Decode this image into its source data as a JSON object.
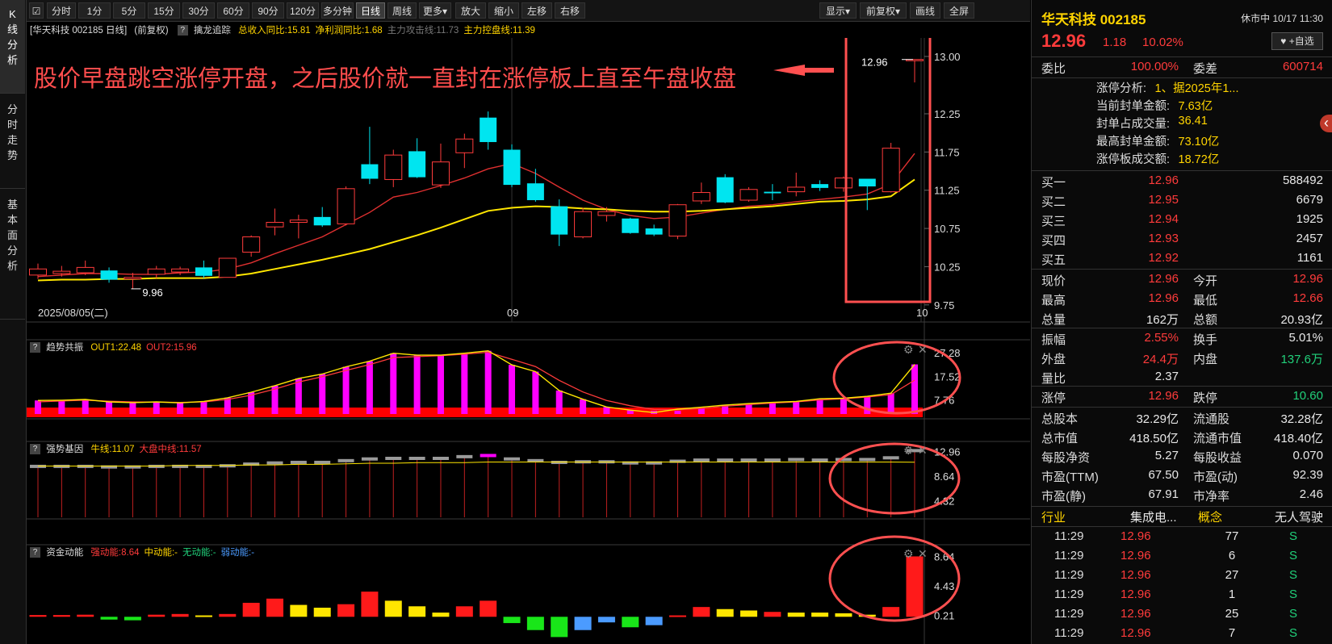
{
  "sidebar": {
    "tabs": [
      {
        "label": "K\n线\n分\n析",
        "active": true
      },
      {
        "label": "分\n时\n走\n势",
        "active": false
      },
      {
        "label": "基\n本\n面\n分\n析",
        "active": false
      }
    ]
  },
  "toolbar": {
    "periods": [
      "分时",
      "1分",
      "5分",
      "15分",
      "30分",
      "60分",
      "90分",
      "120分",
      "多分钟",
      "日线",
      "周线",
      "更多▾"
    ],
    "active_period": "日线",
    "tools": [
      "放大",
      "缩小",
      "左移",
      "右移"
    ],
    "right": [
      "显示▾",
      "前复权▾",
      "画线",
      "全屏"
    ]
  },
  "chart_header": {
    "stock": "[华天科技 002185 日线]",
    "adjust": "(前复权)",
    "indicator": "擒龙追踪",
    "items": [
      {
        "text": "总收入同比:15.81",
        "color": "#ffd400"
      },
      {
        "text": "净利润同比:1.68",
        "color": "#ffd400"
      },
      {
        "text": "主力攻击线:11.73",
        "color": "#777777"
      },
      {
        "text": "主力控盘线:11.39",
        "color": "#ffd400"
      }
    ]
  },
  "annotation": {
    "text": "股价早盘跳空涨停开盘，之后股价就一直封在涨停板上直至午盘收盘",
    "color": "#ff4d4d"
  },
  "chart_data": [
    {
      "type": "candlestick",
      "title": "华天科技 002185 日线",
      "ylim": [
        9.6,
        13.2
      ],
      "y_ticks": [
        "13.00",
        "12.25",
        "11.75",
        "11.25",
        "10.75",
        "10.25",
        "9.75"
      ],
      "x_labels": [
        {
          "index": 0,
          "text": "2025/08/05(二)"
        },
        {
          "index": 20,
          "text": "09"
        },
        {
          "index": 37,
          "text": "10"
        }
      ],
      "max_label": "12.96",
      "min_label": "9.96",
      "candles": [
        {
          "o": 10.14,
          "c": 10.22,
          "h": 10.29,
          "l": 10.09
        },
        {
          "o": 10.16,
          "c": 10.19,
          "h": 10.26,
          "l": 10.12
        },
        {
          "o": 10.17,
          "c": 10.24,
          "h": 10.33,
          "l": 10.14
        },
        {
          "o": 10.2,
          "c": 10.08,
          "h": 10.24,
          "l": 10.04
        },
        {
          "o": 10.09,
          "c": 10.11,
          "h": 10.17,
          "l": 9.96
        },
        {
          "o": 10.15,
          "c": 10.22,
          "h": 10.26,
          "l": 10.1
        },
        {
          "o": 10.18,
          "c": 10.22,
          "h": 10.25,
          "l": 10.14
        },
        {
          "o": 10.24,
          "c": 10.13,
          "h": 10.33,
          "l": 10.1
        },
        {
          "o": 10.11,
          "c": 10.36,
          "h": 10.36,
          "l": 10.11
        },
        {
          "o": 10.44,
          "c": 10.64,
          "h": 10.66,
          "l": 10.38
        },
        {
          "o": 10.77,
          "c": 10.83,
          "h": 11.01,
          "l": 10.66
        },
        {
          "o": 10.83,
          "c": 10.86,
          "h": 10.93,
          "l": 10.62
        },
        {
          "o": 10.9,
          "c": 10.79,
          "h": 11.03,
          "l": 10.77
        },
        {
          "o": 10.81,
          "c": 11.27,
          "h": 11.3,
          "l": 10.79
        },
        {
          "o": 11.59,
          "c": 11.4,
          "h": 12.08,
          "l": 11.33
        },
        {
          "o": 11.39,
          "c": 11.71,
          "h": 11.78,
          "l": 11.29
        },
        {
          "o": 11.76,
          "c": 11.42,
          "h": 11.93,
          "l": 11.41
        },
        {
          "o": 11.32,
          "c": 11.62,
          "h": 11.86,
          "l": 11.28
        },
        {
          "o": 11.74,
          "c": 11.92,
          "h": 11.99,
          "l": 11.54
        },
        {
          "o": 12.2,
          "c": 11.88,
          "h": 12.28,
          "l": 11.78
        },
        {
          "o": 11.78,
          "c": 11.32,
          "h": 11.85,
          "l": 11.29
        },
        {
          "o": 11.34,
          "c": 11.12,
          "h": 11.53,
          "l": 11.1
        },
        {
          "o": 11.04,
          "c": 10.67,
          "h": 11.13,
          "l": 10.52
        },
        {
          "o": 10.64,
          "c": 10.97,
          "h": 11.02,
          "l": 10.62
        },
        {
          "o": 10.92,
          "c": 10.97,
          "h": 11.03,
          "l": 10.84
        },
        {
          "o": 10.88,
          "c": 10.69,
          "h": 10.89,
          "l": 10.68
        },
        {
          "o": 10.75,
          "c": 10.67,
          "h": 10.8,
          "l": 10.65
        },
        {
          "o": 10.65,
          "c": 11.06,
          "h": 11.07,
          "l": 10.61
        },
        {
          "o": 11.11,
          "c": 11.22,
          "h": 11.35,
          "l": 11.07
        },
        {
          "o": 11.42,
          "c": 11.09,
          "h": 11.46,
          "l": 11.08
        },
        {
          "o": 11.12,
          "c": 11.26,
          "h": 11.29,
          "l": 11.1
        },
        {
          "o": 11.23,
          "c": 11.21,
          "h": 11.33,
          "l": 11.12
        },
        {
          "o": 11.23,
          "c": 11.29,
          "h": 11.48,
          "l": 11.17
        },
        {
          "o": 11.33,
          "c": 11.28,
          "h": 11.38,
          "l": 11.24
        },
        {
          "o": 11.28,
          "c": 11.41,
          "h": 11.43,
          "l": 11.23
        },
        {
          "o": 11.4,
          "c": 11.3,
          "h": 11.4,
          "l": 10.99
        },
        {
          "o": 11.23,
          "c": 11.8,
          "h": 11.87,
          "l": 11.22
        },
        {
          "o": 12.96,
          "c": 12.96,
          "h": 12.96,
          "l": 12.66
        }
      ],
      "ma_slow": [
        10.07,
        10.08,
        10.08,
        10.09,
        10.09,
        10.1,
        10.1,
        10.1,
        10.12,
        10.16,
        10.22,
        10.28,
        10.34,
        10.41,
        10.48,
        10.57,
        10.66,
        10.76,
        10.87,
        10.98,
        11.02,
        11.04,
        11.03,
        11.01,
        11.0,
        10.98,
        10.97,
        10.97,
        10.98,
        11.0,
        11.02,
        11.04,
        11.07,
        11.1,
        11.11,
        11.13,
        11.17,
        11.39
      ],
      "ma_fast": [
        10.12,
        10.14,
        10.16,
        10.16,
        10.15,
        10.15,
        10.17,
        10.18,
        10.22,
        10.3,
        10.42,
        10.53,
        10.64,
        10.8,
        10.96,
        11.16,
        11.22,
        11.31,
        11.41,
        11.53,
        11.6,
        11.47,
        11.29,
        11.12,
        11.0,
        10.92,
        10.88,
        10.9,
        10.95,
        11.0,
        11.04,
        11.06,
        11.1,
        11.13,
        11.16,
        11.2,
        11.33,
        11.73
      ]
    },
    {
      "type": "bar",
      "title": "趋势共振",
      "legend": [
        {
          "text": "OUT1:22.48",
          "color": "#ffd400"
        },
        {
          "text": "OUT2:15.96",
          "color": "#ff3b3b"
        }
      ],
      "ylim": [
        2,
        30
      ],
      "y_ticks": [
        "27.28",
        "17.52",
        "7.76"
      ],
      "values": [
        7.6,
        7.7,
        8.0,
        7.0,
        6.7,
        7.0,
        6.6,
        7.2,
        8.7,
        11.0,
        13.7,
        16.7,
        18.5,
        21.5,
        23.8,
        27.1,
        26.3,
        26.3,
        27.1,
        28.1,
        22.3,
        19.5,
        11.7,
        8.1,
        4.9,
        3.6,
        3.3,
        3.3,
        4.4,
        5.7,
        6.3,
        6.8,
        7.2,
        8.3,
        8.5,
        9.3,
        10.6,
        22.48
      ],
      "out1": [
        7.6,
        7.7,
        8.0,
        7.0,
        6.7,
        7.0,
        6.6,
        7.2,
        8.7,
        11.0,
        13.7,
        16.7,
        18.5,
        21.5,
        23.8,
        27.1,
        26.3,
        26.3,
        27.1,
        28.1,
        22.3,
        19.5,
        11.7,
        8.1,
        4.9,
        3.6,
        2.6,
        4.0,
        4.8,
        5.7,
        6.3,
        6.8,
        7.2,
        8.3,
        8.5,
        9.3,
        10.6,
        22.48
      ],
      "out2": [
        7.0,
        7.4,
        7.7,
        7.3,
        7.0,
        6.9,
        6.8,
        7.0,
        8.0,
        9.8,
        12.3,
        15.2,
        17.4,
        20.0,
        22.4,
        25.3,
        25.7,
        26.1,
        26.7,
        27.5,
        24.6,
        21.6,
        15.9,
        11.1,
        7.6,
        5.4,
        3.9,
        3.7,
        4.3,
        5.2,
        5.9,
        6.5,
        7.0,
        7.8,
        8.3,
        9.0,
        10.0,
        15.96
      ]
    },
    {
      "type": "bar",
      "title": "强势基因",
      "legend": [
        {
          "text": "牛线:11.07",
          "color": "#ffd400"
        },
        {
          "text": "大盘中线:11.57",
          "color": "#ff3b3b"
        }
      ],
      "ylim": [
        2,
        14
      ],
      "y_ticks": [
        "12.96",
        "8.64",
        "4.32"
      ],
      "values": [
        10.2,
        10.2,
        10.2,
        10.1,
        10.1,
        10.2,
        10.2,
        10.2,
        10.3,
        10.6,
        10.8,
        10.9,
        10.9,
        11.2,
        11.5,
        11.6,
        11.6,
        11.6,
        11.9,
        12.1,
        11.5,
        11.2,
        10.9,
        11.0,
        11.0,
        10.8,
        10.8,
        11.1,
        11.3,
        11.3,
        11.3,
        11.3,
        11.4,
        11.3,
        11.4,
        11.4,
        11.7,
        12.96
      ],
      "niu": [
        10.4,
        10.4,
        10.4,
        10.4,
        10.4,
        10.4,
        10.5,
        10.5,
        10.5,
        10.6,
        10.6,
        10.7,
        10.7,
        10.8,
        10.9,
        10.9,
        11.0,
        11.0,
        11.0,
        11.1,
        11.1,
        11.1,
        11.1,
        11.1,
        11.1,
        11.1,
        11.1,
        11.1,
        11.1,
        11.1,
        11.1,
        11.1,
        11.1,
        11.1,
        11.1,
        11.1,
        11.1,
        11.07
      ]
    },
    {
      "type": "bar",
      "title": "资金动能",
      "legend": [
        {
          "text": "强动能:8.64",
          "color": "#ff3b3b"
        },
        {
          "text": "中动能:-",
          "color": "#ffd400"
        },
        {
          "text": "无动能:-",
          "color": "#21d07a"
        },
        {
          "text": "弱动能:-",
          "color": "#4b9bff"
        }
      ],
      "ylim": [
        -3.2,
        9.5
      ],
      "y_ticks": [
        "8.64",
        "4.43",
        "0.21"
      ],
      "values": [
        0.25,
        0.25,
        0.3,
        -0.4,
        -0.5,
        0.3,
        0.4,
        0.2,
        0.4,
        2.0,
        2.6,
        1.7,
        1.3,
        1.8,
        3.6,
        2.3,
        1.5,
        0.6,
        1.5,
        2.3,
        -0.9,
        -1.9,
        -2.9,
        -1.9,
        -0.8,
        -1.5,
        -1.2,
        0.2,
        1.4,
        1.1,
        0.9,
        0.7,
        0.6,
        0.6,
        0.5,
        0.3,
        1.4,
        8.64
      ],
      "categories": [
        "strong",
        "strong",
        "strong",
        "none",
        "none",
        "strong",
        "strong",
        "mid",
        "strong",
        "strong",
        "strong",
        "mid",
        "mid",
        "strong",
        "strong",
        "mid",
        "mid",
        "mid",
        "strong",
        "strong",
        "none",
        "none",
        "none",
        "weak",
        "weak",
        "none",
        "weak",
        "strong",
        "strong",
        "mid",
        "mid",
        "strong",
        "mid",
        "mid",
        "mid",
        "mid",
        "strong",
        "strong"
      ]
    }
  ],
  "quote": {
    "name": "华天科技 002185",
    "status": "休市中 10/17 11:30",
    "price": "12.96",
    "change": "1.18",
    "pct": "10.02%",
    "add_label": "♥ +自选",
    "weibi_label": "委比",
    "weibi": "100.00%",
    "weicha_label": "委差",
    "weicha": "600714",
    "limit_info": [
      {
        "k": "涨停分析:",
        "v": "1、据2025年1..."
      },
      {
        "k": "当前封单金额:",
        "v": "7.63亿"
      },
      {
        "k": "封单占成交量:",
        "v": "36.41"
      },
      {
        "k": "最高封单金额:",
        "v": "73.10亿"
      },
      {
        "k": "涨停板成交额:",
        "v": "18.72亿"
      }
    ],
    "bids": [
      {
        "label": "买一",
        "price": "12.96",
        "vol": "588492"
      },
      {
        "label": "买二",
        "price": "12.95",
        "vol": "6679"
      },
      {
        "label": "买三",
        "price": "12.94",
        "vol": "1925"
      },
      {
        "label": "买四",
        "price": "12.93",
        "vol": "2457"
      },
      {
        "label": "买五",
        "price": "12.92",
        "vol": "1161"
      }
    ],
    "stats1": [
      {
        "l1": "现价",
        "v1": "12.96",
        "c1": "red",
        "l2": "今开",
        "v2": "12.96",
        "c2": "red"
      },
      {
        "l1": "最高",
        "v1": "12.96",
        "c1": "red",
        "l2": "最低",
        "v2": "12.66",
        "c2": "red"
      },
      {
        "l1": "总量",
        "v1": "162万",
        "c1": "white",
        "l2": "总额",
        "v2": "20.93亿",
        "c2": "white"
      }
    ],
    "stats2": [
      {
        "l1": "振幅",
        "v1": "2.55%",
        "c1": "red",
        "l2": "换手",
        "v2": "5.01%",
        "c2": "white"
      },
      {
        "l1": "外盘",
        "v1": "24.4万",
        "c1": "red",
        "l2": "内盘",
        "v2": "137.6万",
        "c2": "green"
      },
      {
        "l1": "量比",
        "v1": "2.37",
        "c1": "white",
        "l2": "",
        "v2": "",
        "c2": "white"
      }
    ],
    "stats3": [
      {
        "l1": "涨停",
        "v1": "12.96",
        "c1": "red",
        "l2": "跌停",
        "v2": "10.60",
        "c2": "green"
      }
    ],
    "stats4": [
      {
        "l1": "总股本",
        "v1": "32.29亿",
        "l2": "流通股",
        "v2": "32.28亿"
      },
      {
        "l1": "总市值",
        "v1": "418.50亿",
        "l2": "流通市值",
        "v2": "418.40亿"
      },
      {
        "l1": "每股净资",
        "v1": "5.27",
        "l2": "每股收益",
        "v2": "0.070"
      },
      {
        "l1": "市盈(TTM)",
        "v1": "67.50",
        "l2": "市盈(动)",
        "v2": "92.39"
      },
      {
        "l1": "市盈(静)",
        "v1": "67.91",
        "l2": "市净率",
        "v2": "2.46"
      }
    ],
    "industry": {
      "l1": "行业",
      "v1": "集成电...",
      "l2": "概念",
      "v2": "无人驾驶"
    },
    "ticks": [
      {
        "t": "11:29",
        "p": "12.96",
        "v": "77",
        "s": "S"
      },
      {
        "t": "11:29",
        "p": "12.96",
        "v": "6",
        "s": "S"
      },
      {
        "t": "11:29",
        "p": "12.96",
        "v": "27",
        "s": "S"
      },
      {
        "t": "11:29",
        "p": "12.96",
        "v": "1",
        "s": "S"
      },
      {
        "t": "11:29",
        "p": "12.96",
        "v": "25",
        "s": "S"
      },
      {
        "t": "11:29",
        "p": "12.96",
        "v": "7",
        "s": "S"
      }
    ]
  },
  "colors": {
    "up": "#ff3b3b",
    "down": "#00e5f0",
    "ma_slow": "#ffe600",
    "ma_fast": "#e03030",
    "annotation": "#ff4d4d",
    "bar_magenta": "#ff00ff"
  }
}
